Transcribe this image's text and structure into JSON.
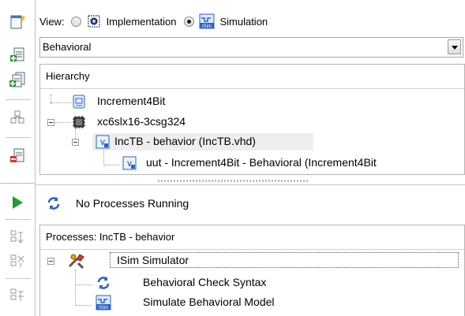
{
  "view": {
    "label": "View:",
    "options": [
      {
        "label": "Implementation",
        "selected": false
      },
      {
        "label": "Simulation",
        "selected": true
      }
    ]
  },
  "combo": {
    "value": "Behavioral"
  },
  "hierarchy": {
    "title": "Hierarchy",
    "items": [
      {
        "label": "Increment4Bit",
        "icon": "project-icon"
      },
      {
        "label": "xc6slx16-3csg324",
        "icon": "chip-icon"
      },
      {
        "label": "IncTB - behavior (IncTB.vhd)",
        "icon": "vhdl-file-icon",
        "selected": true
      },
      {
        "label": "uut - Increment4Bit - Behavioral (Increment4Bit",
        "icon": "vhdl-file-icon"
      }
    ]
  },
  "status": {
    "label": "No Processes Running"
  },
  "processes": {
    "title": "Processes: IncTB - behavior",
    "items": [
      {
        "label": "ISim Simulator",
        "icon": "tools-icon"
      },
      {
        "label": "Behavioral Check Syntax",
        "icon": "refresh-icon"
      },
      {
        "label": "Simulate Behavioral Model",
        "icon": "isim-icon"
      }
    ]
  },
  "colors": {
    "accent_blue": "#2a62c7",
    "run_green": "#1e9e2e",
    "selection_gray": "#eeeeee"
  }
}
